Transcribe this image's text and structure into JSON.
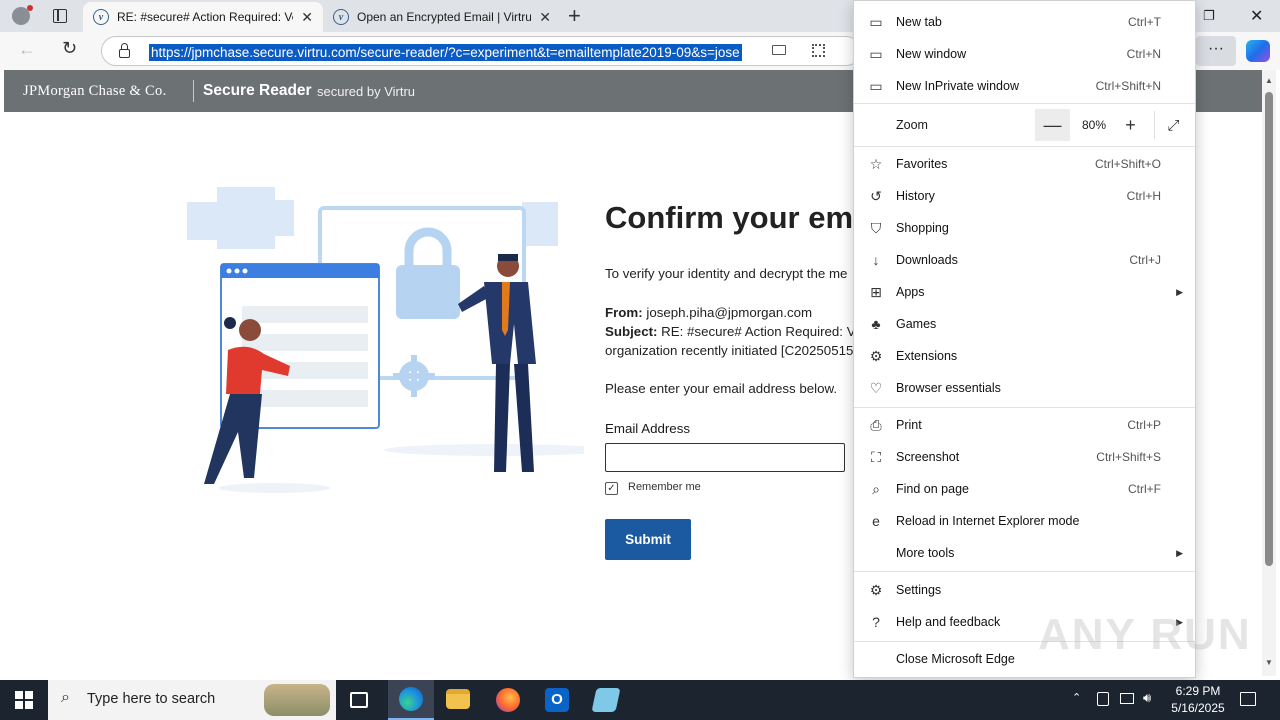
{
  "browser": {
    "tabs": [
      {
        "title": "RE: #secure# Action Required: Ve",
        "active": true
      },
      {
        "title": "Open an Encrypted Email | Virtru",
        "active": false
      }
    ],
    "url": "https://jpmchase.secure.virtru.com/secure-reader/?c=experiment&t=emailtemplate2019-09&s=jose"
  },
  "site": {
    "logo_text": "JPMorgan Chase & Co.",
    "header_title": "Secure Reader",
    "header_sub": "secured by Virtru",
    "heading": "Confirm your ema",
    "verify_text": "To verify your identity and decrypt the me",
    "from_label": "From:",
    "from_value": "joseph.piha@jpmorgan.com",
    "subject_label": "Subject:",
    "subject_value": "RE: #secure# Action Required: Ve",
    "subject_line2": "organization recently initiated [C20250515",
    "prompt": "Please enter your email address below.",
    "email_label": "Email Address",
    "remember_label": "Remember me",
    "submit_label": "Submit"
  },
  "menu": {
    "items": [
      {
        "label": "New tab",
        "shortcut": "Ctrl+T",
        "icon": "new-tab-icon"
      },
      {
        "label": "New window",
        "shortcut": "Ctrl+N",
        "icon": "new-window-icon"
      },
      {
        "label": "New InPrivate window",
        "shortcut": "Ctrl+Shift+N",
        "icon": "inprivate-icon"
      },
      {
        "label": "Zoom"
      },
      {
        "label": "Favorites",
        "shortcut": "Ctrl+Shift+O",
        "icon": "star-icon"
      },
      {
        "label": "History",
        "shortcut": "Ctrl+H",
        "icon": "history-icon"
      },
      {
        "label": "Shopping",
        "icon": "tag-icon"
      },
      {
        "label": "Downloads",
        "shortcut": "Ctrl+J",
        "icon": "download-icon"
      },
      {
        "label": "Apps",
        "icon": "apps-icon"
      },
      {
        "label": "Games",
        "icon": "games-icon"
      },
      {
        "label": "Extensions",
        "icon": "extensions-icon"
      },
      {
        "label": "Browser essentials",
        "icon": "heart-pulse-icon"
      },
      {
        "label": "Print",
        "shortcut": "Ctrl+P",
        "icon": "print-icon"
      },
      {
        "label": "Screenshot",
        "shortcut": "Ctrl+Shift+S",
        "icon": "screenshot-icon"
      },
      {
        "label": "Find on page",
        "shortcut": "Ctrl+F",
        "icon": "find-icon"
      },
      {
        "label": "Reload in Internet Explorer mode",
        "icon": "ie-icon"
      },
      {
        "label": "More tools"
      },
      {
        "label": "Settings",
        "icon": "gear-icon"
      },
      {
        "label": "Help and feedback",
        "icon": "help-icon"
      },
      {
        "label": "Close Microsoft Edge"
      }
    ],
    "zoom_value": "80%"
  },
  "taskbar": {
    "search_placeholder": "Type here to search",
    "time": "6:29 PM",
    "date": "5/16/2025"
  },
  "watermark": "ANY RUN",
  "colors": {
    "header_gray": "#6c7174",
    "submit_blue": "#1b5aa1",
    "url_highlight": "#0a5cc4"
  }
}
